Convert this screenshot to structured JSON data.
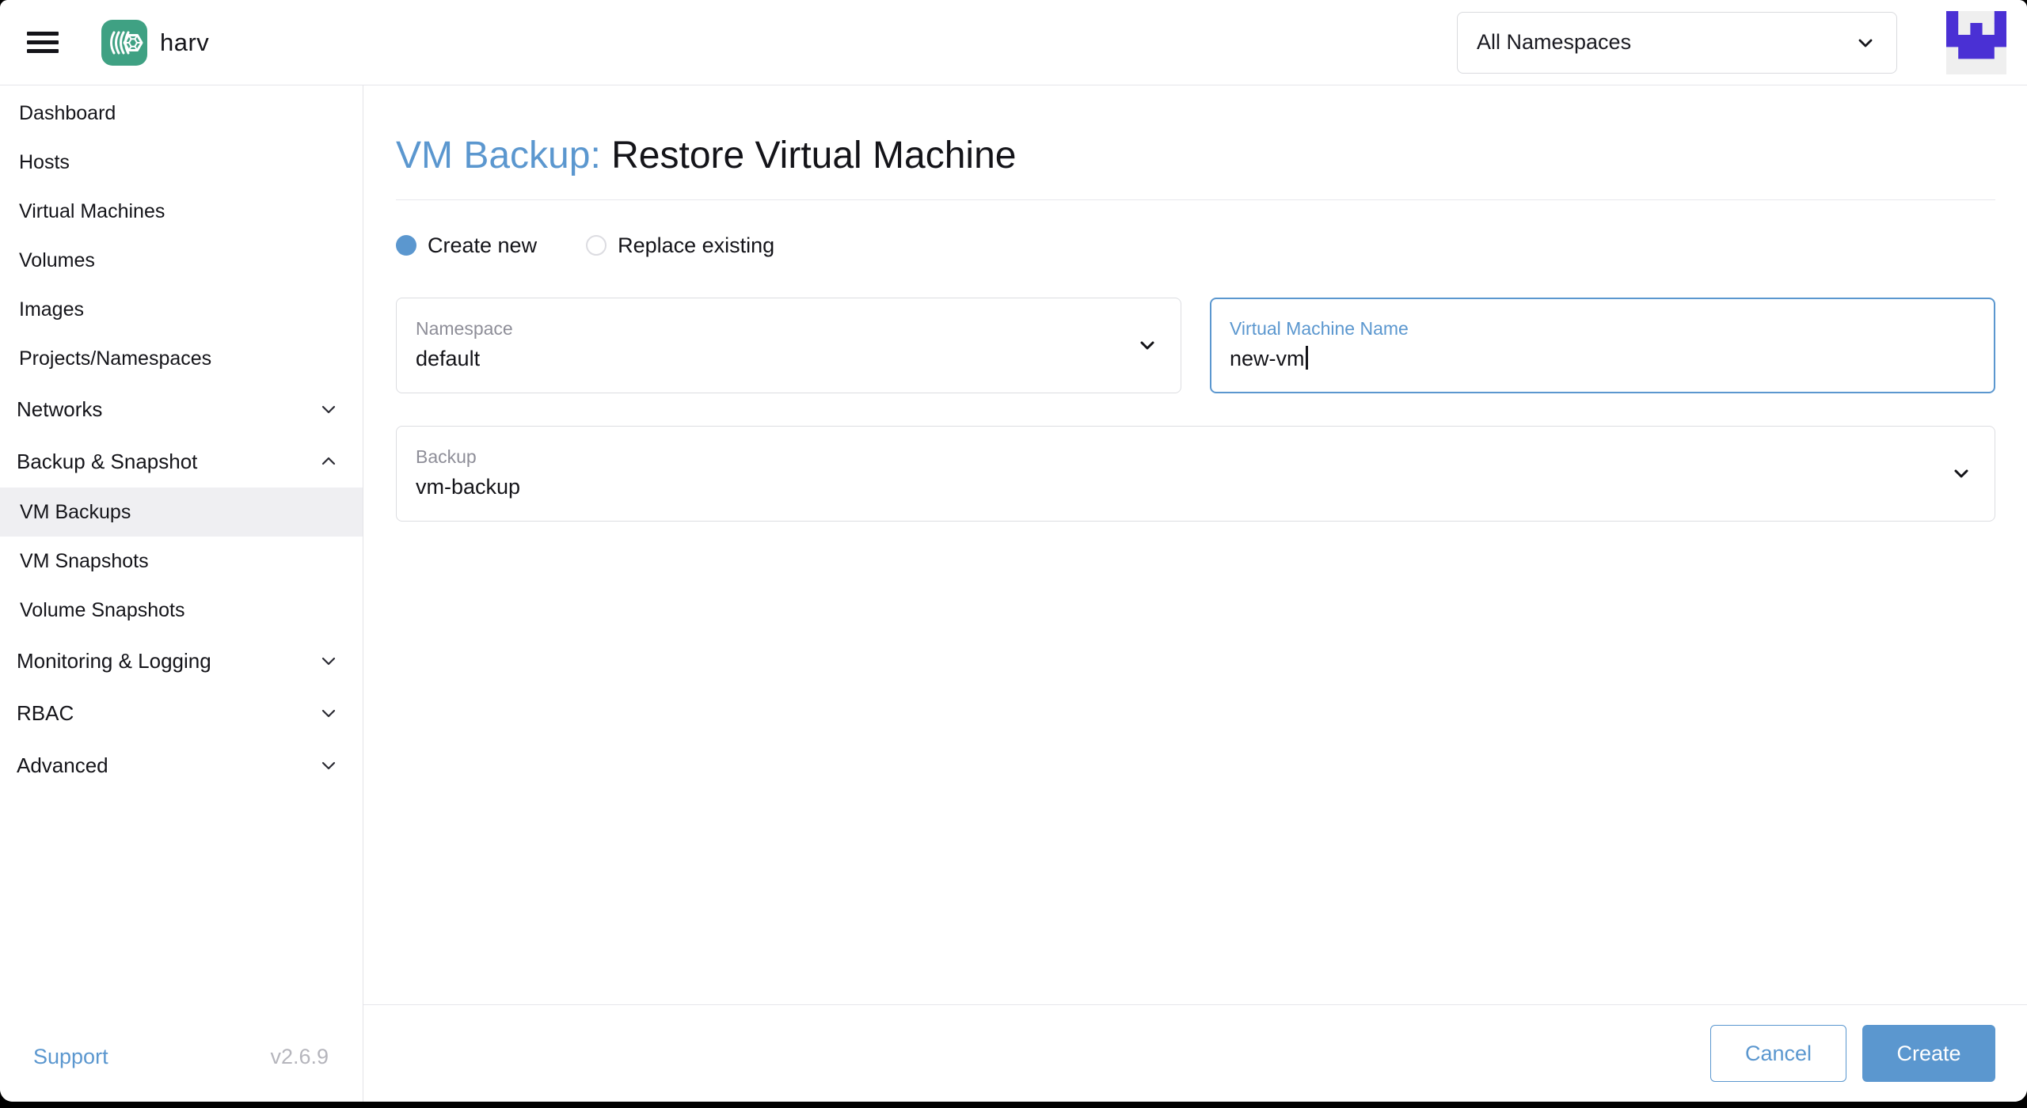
{
  "colors": {
    "accent_blue": "#5b97cf",
    "logo_green": "#3fa183",
    "avatar_purple": "#4a30d4",
    "active_nav_bg": "#efeff2",
    "text_dark": "#141419",
    "label_gray": "#8e8e98"
  },
  "header": {
    "brand": "harv",
    "namespace_select": {
      "value": "All Namespaces"
    }
  },
  "sidebar": {
    "items": [
      {
        "label": "Dashboard"
      },
      {
        "label": "Hosts"
      },
      {
        "label": "Virtual Machines"
      },
      {
        "label": "Volumes"
      },
      {
        "label": "Images"
      },
      {
        "label": "Projects/Namespaces"
      },
      {
        "label": "Networks",
        "group": true,
        "expandable": true,
        "expanded": false
      },
      {
        "label": "Backup & Snapshot",
        "group": true,
        "expandable": true,
        "expanded": true
      },
      {
        "label": "VM Backups",
        "child": true,
        "active": true
      },
      {
        "label": "VM Snapshots",
        "child": true
      },
      {
        "label": "Volume Snapshots",
        "child": true
      },
      {
        "label": "Monitoring & Logging",
        "group": true,
        "expandable": true,
        "expanded": false
      },
      {
        "label": "RBAC",
        "group": true,
        "expandable": true,
        "expanded": false
      },
      {
        "label": "Advanced",
        "group": true,
        "expandable": true,
        "expanded": false
      }
    ],
    "footer": {
      "support_label": "Support",
      "version": "v2.6.9"
    }
  },
  "main": {
    "title_prefix": "VM Backup:",
    "title": "Restore Virtual Machine",
    "radios": [
      {
        "label": "Create new",
        "selected": true
      },
      {
        "label": "Replace existing",
        "selected": false
      }
    ],
    "fields": {
      "namespace": {
        "label": "Namespace",
        "value": "default"
      },
      "vm_name": {
        "label": "Virtual Machine Name",
        "value": "new-vm",
        "focused": true
      },
      "backup": {
        "label": "Backup",
        "value": "vm-backup"
      }
    },
    "actions": {
      "cancel_label": "Cancel",
      "create_label": "Create"
    }
  }
}
